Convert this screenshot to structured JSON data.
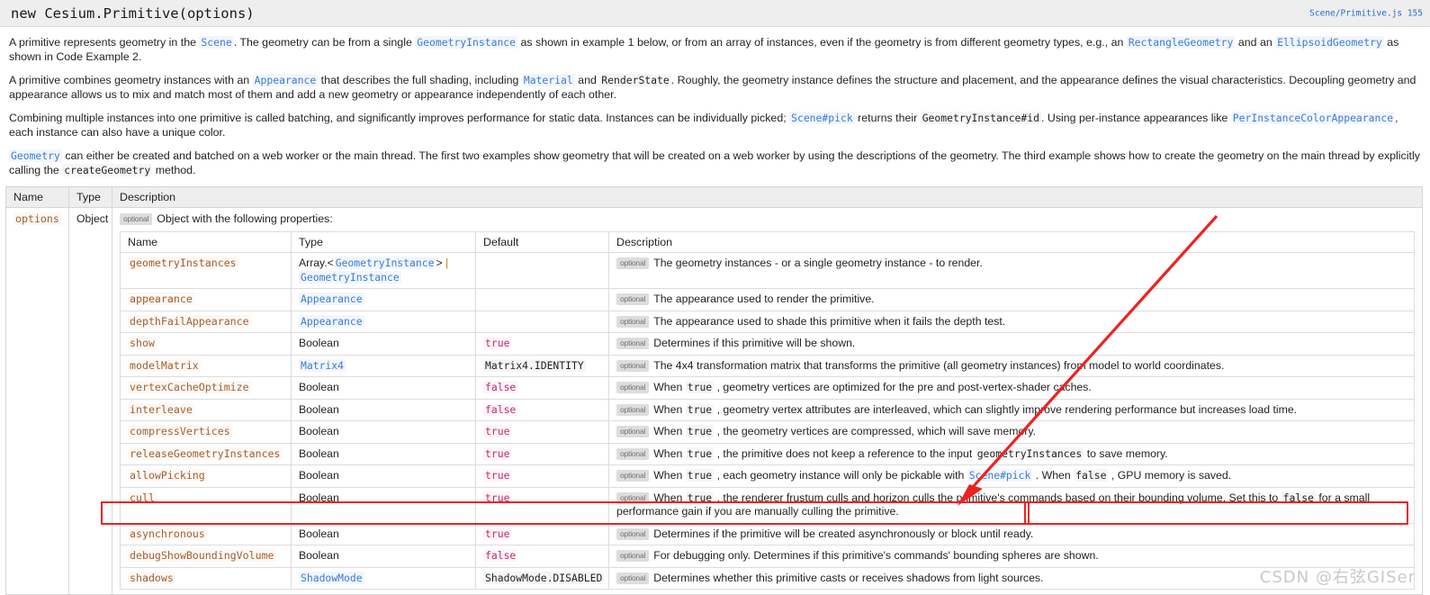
{
  "header": {
    "signature": "new Cesium.Primitive(options)",
    "source_link": "Scene/Primitive.js 155"
  },
  "description": {
    "p1": [
      {
        "t": "text",
        "v": "A primitive represents geometry in the "
      },
      {
        "t": "codelink",
        "v": "Scene"
      },
      {
        "t": "text",
        "v": ". The geometry can be from a single "
      },
      {
        "t": "codelink",
        "v": "GeometryInstance"
      },
      {
        "t": "text",
        "v": " as shown in example 1 below, or from an array of instances, even if the geometry is from different geometry types, e.g., an "
      },
      {
        "t": "codelink",
        "v": "RectangleGeometry"
      },
      {
        "t": "text",
        "v": " and an "
      },
      {
        "t": "codelink",
        "v": "EllipsoidGeometry"
      },
      {
        "t": "text",
        "v": " as shown in Code Example 2."
      }
    ],
    "p2": [
      {
        "t": "text",
        "v": "A primitive combines geometry instances with an "
      },
      {
        "t": "codelink",
        "v": "Appearance"
      },
      {
        "t": "text",
        "v": " that describes the full shading, including "
      },
      {
        "t": "codelink",
        "v": "Material"
      },
      {
        "t": "text",
        "v": " and "
      },
      {
        "t": "code",
        "v": "RenderState"
      },
      {
        "t": "text",
        "v": ". Roughly, the geometry instance defines the structure and placement, and the appearance defines the visual characteristics. Decoupling geometry and appearance allows us to mix and match most of them and add a new geometry or appearance independently of each other."
      }
    ],
    "p3": [
      {
        "t": "text",
        "v": "Combining multiple instances into one primitive is called batching, and significantly improves performance for static data. Instances can be individually picked; "
      },
      {
        "t": "codelink",
        "v": "Scene#pick"
      },
      {
        "t": "text",
        "v": " returns their "
      },
      {
        "t": "code",
        "v": "GeometryInstance#id"
      },
      {
        "t": "text",
        "v": ". Using per-instance appearances like "
      },
      {
        "t": "codelink",
        "v": "PerInstanceColorAppearance"
      },
      {
        "t": "text",
        "v": ", each instance can also have a unique color."
      }
    ],
    "p4": [
      {
        "t": "codelink",
        "v": "Geometry"
      },
      {
        "t": "text",
        "v": " can either be created and batched on a web worker or the main thread. The first two examples show geometry that will be created on a web worker by using the descriptions of the geometry. The third example shows how to create the geometry on the main thread by explicitly calling the "
      },
      {
        "t": "code",
        "v": "createGeometry"
      },
      {
        "t": "text",
        "v": " method."
      }
    ]
  },
  "params_table": {
    "columns": [
      "Name",
      "Type",
      "Description"
    ],
    "row": {
      "name": "options",
      "type": "Object",
      "optional_tag": "optional",
      "description_intro": "Object with the following properties:"
    }
  },
  "props_table": {
    "columns": [
      "Name",
      "Type",
      "Default",
      "Description"
    ],
    "rows": [
      {
        "name": "geometryInstances",
        "type_parts": [
          {
            "t": "text",
            "v": "Array.<"
          },
          {
            "t": "link",
            "v": "GeometryInstance"
          },
          {
            "t": "text",
            "v": "> "
          },
          {
            "t": "sep",
            "v": "|"
          },
          {
            "t": "break",
            "v": ""
          },
          {
            "t": "link",
            "v": "GeometryInstance"
          }
        ],
        "default": null,
        "optional_tag": "optional",
        "desc_parts": [
          {
            "t": "text",
            "v": "The geometry instances - or a single geometry instance - to render."
          }
        ]
      },
      {
        "name": "appearance",
        "type_parts": [
          {
            "t": "link",
            "v": "Appearance"
          }
        ],
        "default": null,
        "optional_tag": "optional",
        "desc_parts": [
          {
            "t": "text",
            "v": "The appearance used to render the primitive."
          }
        ]
      },
      {
        "name": "depthFailAppearance",
        "type_parts": [
          {
            "t": "link",
            "v": "Appearance"
          }
        ],
        "default": null,
        "optional_tag": "optional",
        "desc_parts": [
          {
            "t": "text",
            "v": "The appearance used to shade this primitive when it fails the depth test."
          }
        ]
      },
      {
        "name": "show",
        "type_parts": [
          {
            "t": "text",
            "v": "Boolean"
          }
        ],
        "default": "true",
        "default_style": "bool",
        "optional_tag": "optional",
        "desc_parts": [
          {
            "t": "text",
            "v": "Determines if this primitive will be shown."
          }
        ]
      },
      {
        "name": "modelMatrix",
        "type_parts": [
          {
            "t": "link",
            "v": "Matrix4"
          }
        ],
        "default": "Matrix4.IDENTITY",
        "default_style": "plain",
        "optional_tag": "optional",
        "desc_parts": [
          {
            "t": "text",
            "v": "The 4x4 transformation matrix that transforms the primitive (all geometry instances) from model to world coordinates."
          }
        ]
      },
      {
        "name": "vertexCacheOptimize",
        "type_parts": [
          {
            "t": "text",
            "v": "Boolean"
          }
        ],
        "default": "false",
        "default_style": "bool",
        "optional_tag": "optional",
        "desc_parts": [
          {
            "t": "text",
            "v": "When "
          },
          {
            "t": "code",
            "v": "true"
          },
          {
            "t": "text",
            "v": " , geometry vertices are optimized for the pre and post-vertex-shader caches."
          }
        ]
      },
      {
        "name": "interleave",
        "type_parts": [
          {
            "t": "text",
            "v": "Boolean"
          }
        ],
        "default": "false",
        "default_style": "bool",
        "optional_tag": "optional",
        "desc_parts": [
          {
            "t": "text",
            "v": "When "
          },
          {
            "t": "code",
            "v": "true"
          },
          {
            "t": "text",
            "v": " , geometry vertex attributes are interleaved, which can slightly improve rendering performance but increases load time."
          }
        ]
      },
      {
        "name": "compressVertices",
        "type_parts": [
          {
            "t": "text",
            "v": "Boolean"
          }
        ],
        "default": "true",
        "default_style": "bool",
        "optional_tag": "optional",
        "desc_parts": [
          {
            "t": "text",
            "v": "When "
          },
          {
            "t": "code",
            "v": "true"
          },
          {
            "t": "text",
            "v": " , the geometry vertices are compressed, which will save memory."
          }
        ]
      },
      {
        "name": "releaseGeometryInstances",
        "type_parts": [
          {
            "t": "text",
            "v": "Boolean"
          }
        ],
        "default": "true",
        "default_style": "bool",
        "optional_tag": "optional",
        "desc_parts": [
          {
            "t": "text",
            "v": "When "
          },
          {
            "t": "code",
            "v": "true"
          },
          {
            "t": "text",
            "v": " , the primitive does not keep a reference to the input "
          },
          {
            "t": "code",
            "v": "geometryInstances"
          },
          {
            "t": "text",
            "v": " to save memory."
          }
        ]
      },
      {
        "name": "allowPicking",
        "type_parts": [
          {
            "t": "text",
            "v": "Boolean"
          }
        ],
        "default": "true",
        "default_style": "bool",
        "optional_tag": "optional",
        "desc_parts": [
          {
            "t": "text",
            "v": "When "
          },
          {
            "t": "code",
            "v": "true"
          },
          {
            "t": "text",
            "v": " , each geometry instance will only be pickable with "
          },
          {
            "t": "link",
            "v": "Scene#pick"
          },
          {
            "t": "text",
            "v": " . When "
          },
          {
            "t": "code",
            "v": "false"
          },
          {
            "t": "text",
            "v": " , GPU memory is saved."
          }
        ]
      },
      {
        "name": "cull",
        "type_parts": [
          {
            "t": "text",
            "v": "Boolean"
          }
        ],
        "default": "true",
        "default_style": "bool",
        "optional_tag": "optional",
        "desc_parts": [
          {
            "t": "text",
            "v": "When "
          },
          {
            "t": "code",
            "v": "true"
          },
          {
            "t": "text",
            "v": " , the renderer frustum culls and horizon culls the primitive's commands based on their bounding volume. Set this to "
          },
          {
            "t": "code",
            "v": "false"
          },
          {
            "t": "text",
            "v": " for a small performance gain if you are manually culling the primitive."
          }
        ]
      },
      {
        "name": "asynchronous",
        "type_parts": [
          {
            "t": "text",
            "v": "Boolean"
          }
        ],
        "default": "true",
        "default_style": "bool",
        "optional_tag": "optional",
        "highlighted": true,
        "desc_parts": [
          {
            "t": "text",
            "v": "Determines if the primitive will be created asynchronously or block until ready."
          }
        ]
      },
      {
        "name": "debugShowBoundingVolume",
        "type_parts": [
          {
            "t": "text",
            "v": "Boolean"
          }
        ],
        "default": "false",
        "default_style": "bool",
        "optional_tag": "optional",
        "desc_parts": [
          {
            "t": "text",
            "v": "For debugging only. Determines if this primitive's commands' bounding spheres are shown."
          }
        ]
      },
      {
        "name": "shadows",
        "type_parts": [
          {
            "t": "link",
            "v": "ShadowMode"
          }
        ],
        "default": "ShadowMode.DISABLED",
        "default_style": "plain",
        "optional_tag": "optional",
        "desc_parts": [
          {
            "t": "text",
            "v": "Determines whether this primitive casts or receives shadows from light sources."
          }
        ]
      }
    ]
  },
  "annotations": {
    "highlight_color": "#ee2222",
    "arrow_color": "#ee2222"
  },
  "watermark": "CSDN @右弦GISer"
}
